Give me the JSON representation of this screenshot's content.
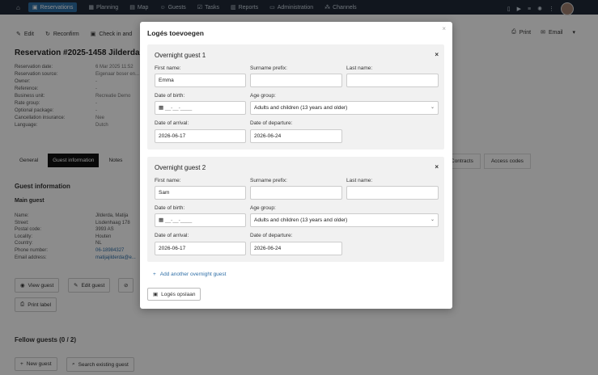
{
  "nav": {
    "items": [
      {
        "label": "Reservations",
        "active": true
      },
      {
        "label": "Planning"
      },
      {
        "label": "Map"
      },
      {
        "label": "Guests"
      },
      {
        "label": "Tasks"
      },
      {
        "label": "Reports"
      },
      {
        "label": "Administration"
      },
      {
        "label": "Channels"
      }
    ]
  },
  "toolbar": {
    "edit": "Edit",
    "reconfirm": "Reconfirm",
    "checkin": "Check in and",
    "print": "Print",
    "email": "Email"
  },
  "reservation": {
    "title": "Reservation #2025-1458 Jilderda",
    "details": [
      {
        "k": "Reservation date:",
        "v": "6 Mar 2025 11:52"
      },
      {
        "k": "Reservation source:",
        "v": "Eigenaar boser en..."
      },
      {
        "k": "Owner:",
        "v": "-"
      },
      {
        "k": "Reference:",
        "v": "-"
      },
      {
        "k": "Business unit:",
        "v": "Recreatie Demo"
      },
      {
        "k": "Rate group:",
        "v": "-"
      },
      {
        "k": "Optional package:",
        "v": "-"
      },
      {
        "k": "Cancellation insurance:",
        "v": "Nee"
      },
      {
        "k": "Language:",
        "v": "Dutch"
      }
    ]
  },
  "tabs": {
    "left": [
      "General",
      "Guest information",
      "Notes"
    ],
    "right": [
      "Contracts",
      "Access codes"
    ]
  },
  "guest_info": {
    "heading": "Guest information",
    "main_guest": "Main guest",
    "rows": [
      {
        "k": "Name:",
        "v": "Jilderda, Matija"
      },
      {
        "k": "Street:",
        "v": "Lisdenhaag 178"
      },
      {
        "k": "Postal code:",
        "v": "3993 AS"
      },
      {
        "k": "Locality:",
        "v": "Houten"
      },
      {
        "k": "Country:",
        "v": "NL"
      },
      {
        "k": "Phone number:",
        "v": "06-18984327"
      },
      {
        "k": "Email address:",
        "v": "matijajilderda@e..."
      }
    ],
    "view_guest": "View guest",
    "edit_guest": "Edit guest",
    "print_label": "Print label"
  },
  "fellow": {
    "heading": "Fellow guests (0 / 2)",
    "new_guest": "New guest",
    "search_guest": "Search existing guest"
  },
  "modal": {
    "title": "Logés toevoegen",
    "labels": {
      "first_name": "First name:",
      "surname_prefix": "Surname prefix:",
      "last_name": "Last name:",
      "dob": "Date of birth:",
      "age_group": "Age group:",
      "arrival": "Date of arrival:",
      "departure": "Date of departure:"
    },
    "date_placeholder": "__-__-____",
    "guests": [
      {
        "title": "Overnight guest 1",
        "first_name": "Emma",
        "surname_prefix": "",
        "last_name": "",
        "age_group": "Adults and children (13 years and older)",
        "arrival": "2026-06-17",
        "departure": "2026-06-24"
      },
      {
        "title": "Overnight guest 2",
        "first_name": "Sam",
        "surname_prefix": "",
        "last_name": "",
        "age_group": "Adults and children (13 years and older)",
        "arrival": "2026-06-17",
        "departure": "2026-06-24"
      }
    ],
    "add_link": "Add another overnight guest",
    "save": "Logés opslaan"
  }
}
